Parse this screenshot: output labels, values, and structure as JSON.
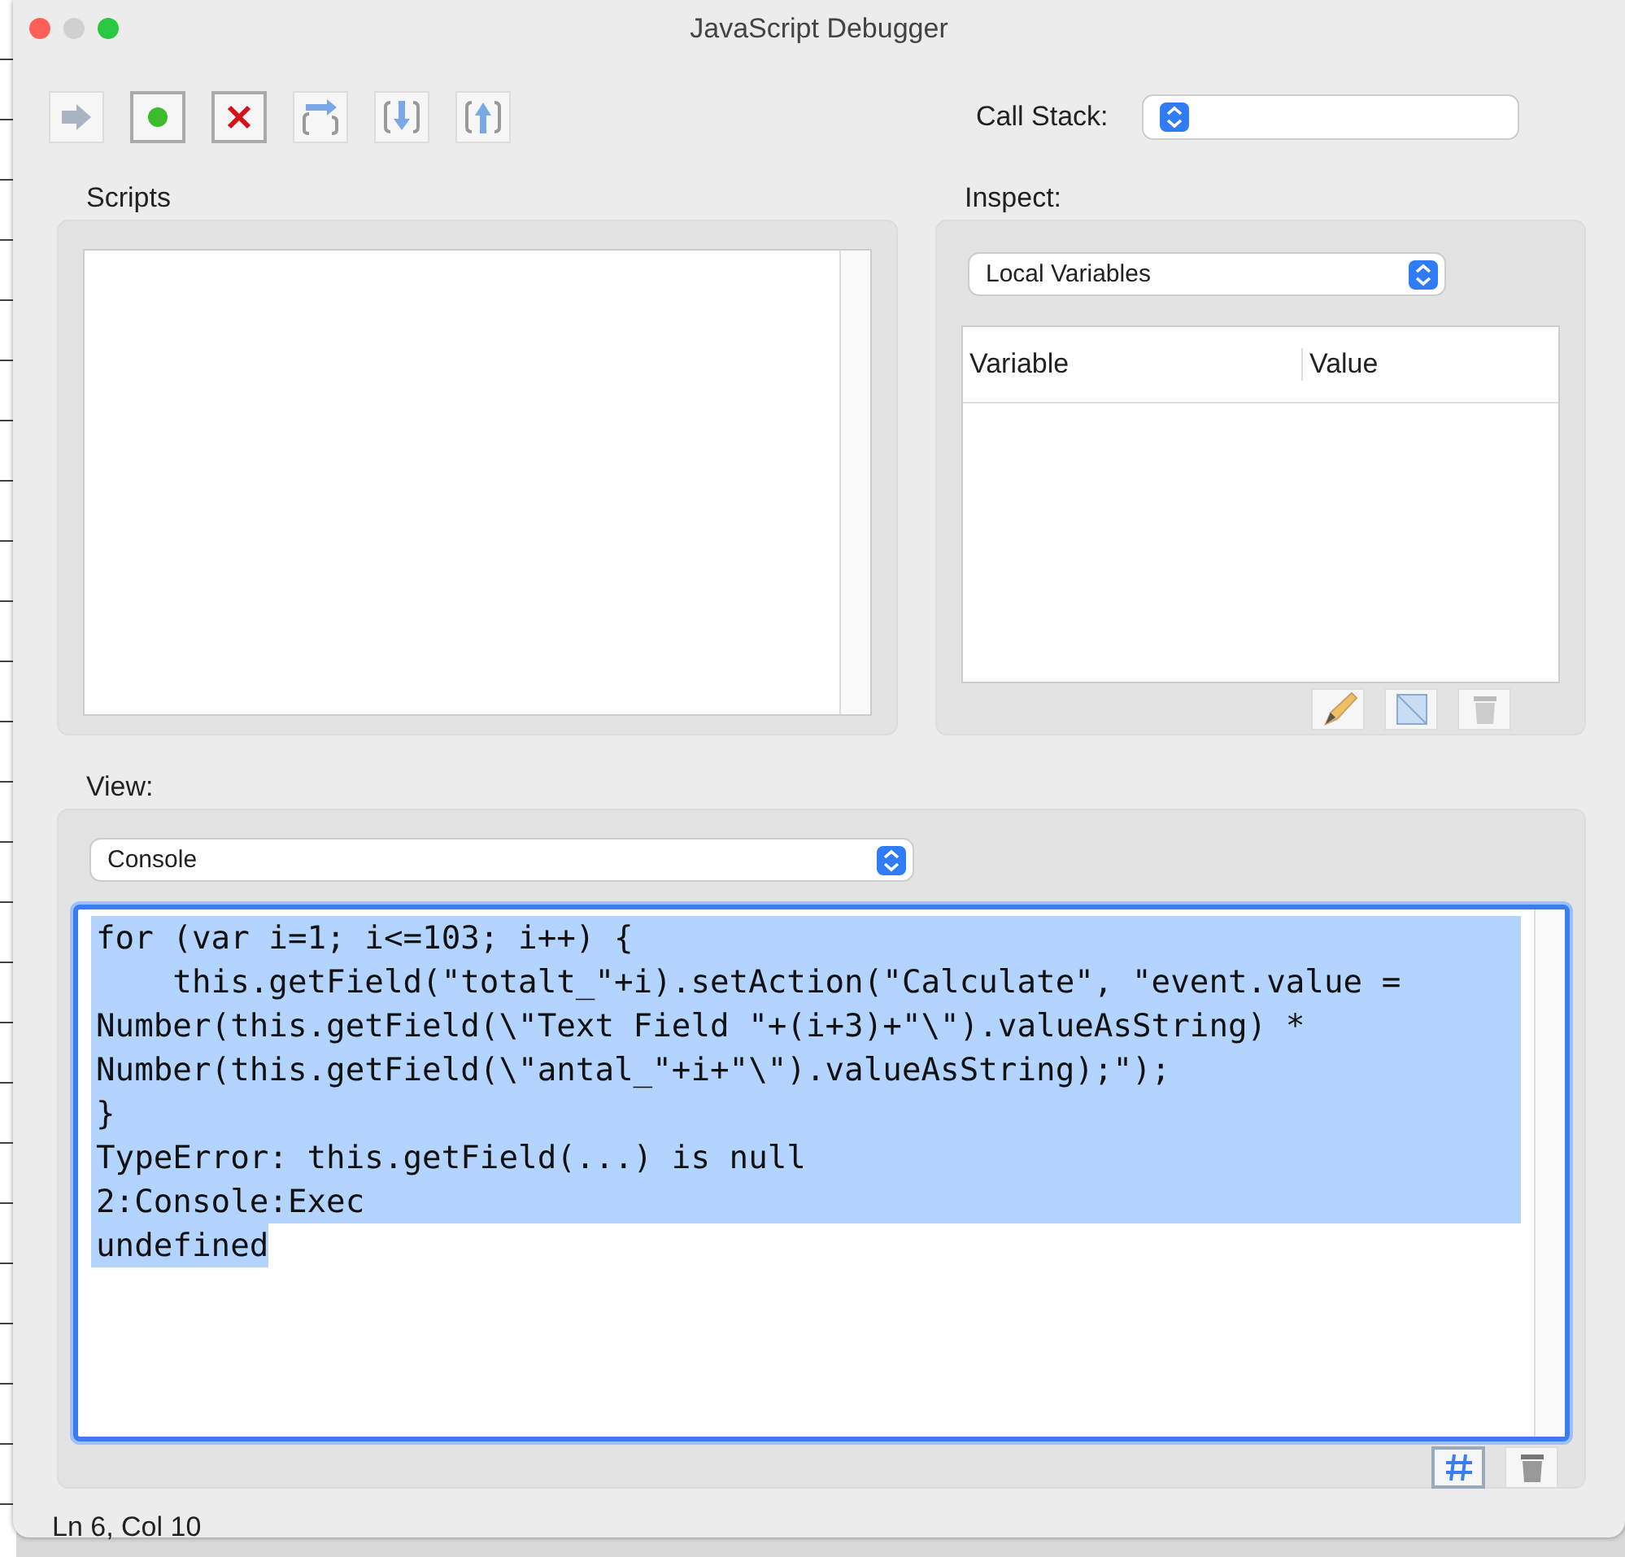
{
  "window": {
    "title": "JavaScript Debugger"
  },
  "toolbar": {
    "call_stack_label": "Call Stack:"
  },
  "scripts": {
    "label": "Scripts"
  },
  "inspect": {
    "label": "Inspect:",
    "select": "Local Variables",
    "columns": [
      "Variable",
      "Value"
    ]
  },
  "view": {
    "label": "View:",
    "select": "Console"
  },
  "console": {
    "selected": true,
    "lines": [
      "for (var i=1; i<=103; i++) {",
      "    this.getField(\"totalt_\"+i).setAction(\"Calculate\", \"event.value =",
      "Number(this.getField(\\\"Text Field \"+(i+3)+\"\\\").valueAsString) *",
      "Number(this.getField(\\\"antal_\"+i+\"\\\").valueAsString);\");",
      "}",
      "TypeError: this.getField(...) is null",
      "2:Console:Exec",
      "undefined"
    ]
  },
  "status_bar": "Ln 6, Col 10"
}
